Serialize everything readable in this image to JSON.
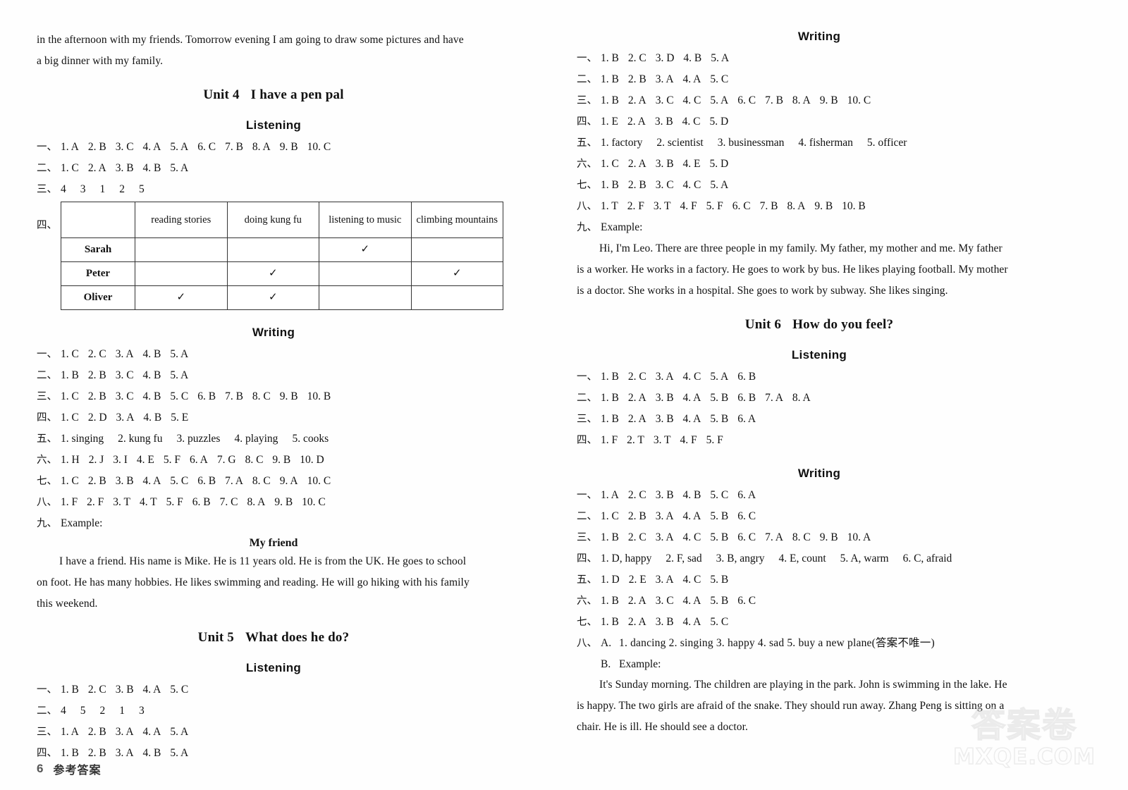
{
  "footer": {
    "page_number": "6",
    "label": "参考答案"
  },
  "watermark": {
    "cn": "答案卷",
    "en": "MXQE.COM"
  },
  "left_column": {
    "carryover_paragraph": {
      "line1": "in the afternoon with my friends. Tomorrow evening I am going to draw some pictures and have",
      "line2": "a big dinner with my family."
    },
    "unit4": {
      "unit_no": "Unit 4",
      "unit_title": "I have a pen pal",
      "listening": {
        "heading": "Listening",
        "rows": [
          {
            "label": "一、",
            "items": [
              "1. A",
              "2. B",
              "3. C",
              "4. A",
              "5. A",
              "6. C",
              "7. B",
              "8. A",
              "9. B",
              "10. C"
            ]
          },
          {
            "label": "二、",
            "items": [
              "1. C",
              "2. A",
              "3. B",
              "4. B",
              "5. A"
            ]
          },
          {
            "label": "三、",
            "items": [
              "4",
              "3",
              "1",
              "2",
              "5"
            ]
          }
        ],
        "table": {
          "label": "四、",
          "columns": [
            "",
            "reading stories",
            "doing kung fu",
            "listening to music",
            "climbing mountains"
          ],
          "rows": [
            {
              "name": "Sarah",
              "marks": [
                false,
                false,
                true,
                false
              ]
            },
            {
              "name": "Peter",
              "marks": [
                false,
                true,
                false,
                true
              ]
            },
            {
              "name": "Oliver",
              "marks": [
                true,
                true,
                false,
                false
              ]
            }
          ],
          "tick": "✓"
        }
      },
      "writing": {
        "heading": "Writing",
        "rows": [
          {
            "label": "一、",
            "items": [
              "1. C",
              "2. C",
              "3. A",
              "4. B",
              "5. A"
            ]
          },
          {
            "label": "二、",
            "items": [
              "1. B",
              "2. B",
              "3. C",
              "4. B",
              "5. A"
            ]
          },
          {
            "label": "三、",
            "items": [
              "1. C",
              "2. B",
              "3. C",
              "4. B",
              "5. C",
              "6. B",
              "7. B",
              "8. C",
              "9. B",
              "10. B"
            ]
          },
          {
            "label": "四、",
            "items": [
              "1. C",
              "2. D",
              "3. A",
              "4. B",
              "5. E"
            ]
          },
          {
            "label": "五、",
            "items": [
              "1. singing",
              "2. kung fu",
              "3. puzzles",
              "4. playing",
              "5. cooks"
            ],
            "wide": true
          },
          {
            "label": "六、",
            "items": [
              "1. H",
              "2. J",
              "3. I",
              "4. E",
              "5. F",
              "6. A",
              "7. G",
              "8. C",
              "9. B",
              "10. D"
            ]
          },
          {
            "label": "七、",
            "items": [
              "1. C",
              "2. B",
              "3. B",
              "4. A",
              "5. C",
              "6. B",
              "7. A",
              "8. C",
              "9. A",
              "10. C"
            ]
          },
          {
            "label": "八、",
            "items": [
              "1. F",
              "2. F",
              "3. T",
              "4. T",
              "5. F",
              "6. B",
              "7. C",
              "8. A",
              "9. B",
              "10. C"
            ]
          }
        ],
        "example": {
          "label": "九、",
          "intro": "Example:",
          "title": "My friend",
          "line1": "I have a friend. His name is Mike. He is 11 years old. He is from the UK. He goes to school",
          "line2": "on foot. He has many hobbies. He likes swimming and reading. He will go hiking with his family",
          "line3": "this weekend."
        }
      }
    },
    "unit5": {
      "unit_no": "Unit 5",
      "unit_title": "What does he do?",
      "listening": {
        "heading": "Listening",
        "rows": [
          {
            "label": "一、",
            "items": [
              "1. B",
              "2. C",
              "3. B",
              "4. A",
              "5. C"
            ]
          },
          {
            "label": "二、",
            "items": [
              "4",
              "5",
              "2",
              "1",
              "3"
            ]
          },
          {
            "label": "三、",
            "items": [
              "1. A",
              "2. B",
              "3. A",
              "4. A",
              "5. A"
            ]
          },
          {
            "label": "四、",
            "items": [
              "1. B",
              "2. B",
              "3. A",
              "4. B",
              "5. A"
            ]
          }
        ]
      }
    }
  },
  "right_column": {
    "unit5_writing": {
      "heading": "Writing",
      "rows": [
        {
          "label": "一、",
          "items": [
            "1. B",
            "2. C",
            "3. D",
            "4. B",
            "5. A"
          ]
        },
        {
          "label": "二、",
          "items": [
            "1. B",
            "2. B",
            "3. A",
            "4. A",
            "5. C"
          ]
        },
        {
          "label": "三、",
          "items": [
            "1. B",
            "2. A",
            "3. C",
            "4. C",
            "5. A",
            "6. C",
            "7. B",
            "8. A",
            "9. B",
            "10. C"
          ]
        },
        {
          "label": "四、",
          "items": [
            "1. E",
            "2. A",
            "3. B",
            "4. C",
            "5. D"
          ]
        },
        {
          "label": "五、",
          "items": [
            "1. factory",
            "2. scientist",
            "3. businessman",
            "4. fisherman",
            "5. officer"
          ],
          "wide": true
        },
        {
          "label": "六、",
          "items": [
            "1. C",
            "2. A",
            "3. B",
            "4. E",
            "5. D"
          ]
        },
        {
          "label": "七、",
          "items": [
            "1. B",
            "2. B",
            "3. C",
            "4. C",
            "5. A"
          ]
        },
        {
          "label": "八、",
          "items": [
            "1. T",
            "2. F",
            "3. T",
            "4. F",
            "5. F",
            "6. C",
            "7. B",
            "8. A",
            "9. B",
            "10. B"
          ]
        }
      ],
      "example": {
        "label": "九、",
        "intro": "Example:",
        "line1": "Hi, I'm Leo. There are three people in my family. My father, my mother and me. My father",
        "line2": "is a worker. He works in a factory. He goes to work by bus. He likes playing football. My mother",
        "line3": "is a doctor. She works in a hospital. She goes to work by subway. She likes singing."
      }
    },
    "unit6": {
      "unit_no": "Unit 6",
      "unit_title": "How do you feel?",
      "listening": {
        "heading": "Listening",
        "rows": [
          {
            "label": "一、",
            "items": [
              "1. B",
              "2. C",
              "3. A",
              "4. C",
              "5. A",
              "6. B"
            ]
          },
          {
            "label": "二、",
            "items": [
              "1. B",
              "2. A",
              "3. B",
              "4. A",
              "5. B",
              "6. B",
              "7. A",
              "8. A"
            ]
          },
          {
            "label": "三、",
            "items": [
              "1. B",
              "2. A",
              "3. B",
              "4. A",
              "5. B",
              "6. A"
            ]
          },
          {
            "label": "四、",
            "items": [
              "1. F",
              "2. T",
              "3. T",
              "4. F",
              "5. F"
            ]
          }
        ]
      },
      "writing": {
        "heading": "Writing",
        "rows": [
          {
            "label": "一、",
            "items": [
              "1. A",
              "2. C",
              "3. B",
              "4. B",
              "5. C",
              "6. A"
            ]
          },
          {
            "label": "二、",
            "items": [
              "1. C",
              "2. B",
              "3. A",
              "4. A",
              "5. B",
              "6. C"
            ]
          },
          {
            "label": "三、",
            "items": [
              "1. B",
              "2. C",
              "3. A",
              "4. C",
              "5. B",
              "6. C",
              "7. A",
              "8. C",
              "9. B",
              "10. A"
            ]
          },
          {
            "label": "四、",
            "items": [
              "1. D, happy",
              "2. F, sad",
              "3. B, angry",
              "4. E, count",
              "5. A, warm",
              "6. C, afraid"
            ],
            "wide": true
          },
          {
            "label": "五、",
            "items": [
              "1. D",
              "2. E",
              "3. A",
              "4. C",
              "5. B"
            ]
          },
          {
            "label": "六、",
            "items": [
              "1. B",
              "2. A",
              "3. C",
              "4. A",
              "5. B",
              "6. C"
            ]
          },
          {
            "label": "七、",
            "items": [
              "1. B",
              "2. A",
              "3. B",
              "4. A",
              "5. C"
            ]
          }
        ],
        "part8": {
          "label": "八、",
          "a_letter": "A.",
          "a_items": "1. dancing   2. singing   3. happy   4. sad   5. buy a new plane(答案不唯一)",
          "b_letter": "B.",
          "b_intro": "Example:",
          "line1": "It's Sunday morning. The children are playing in the park. John is swimming in the lake. He",
          "line2": "is happy. The two girls are afraid of the snake. They should run away. Zhang Peng is sitting on a",
          "line3": "chair. He is ill. He should see a doctor."
        }
      }
    }
  }
}
